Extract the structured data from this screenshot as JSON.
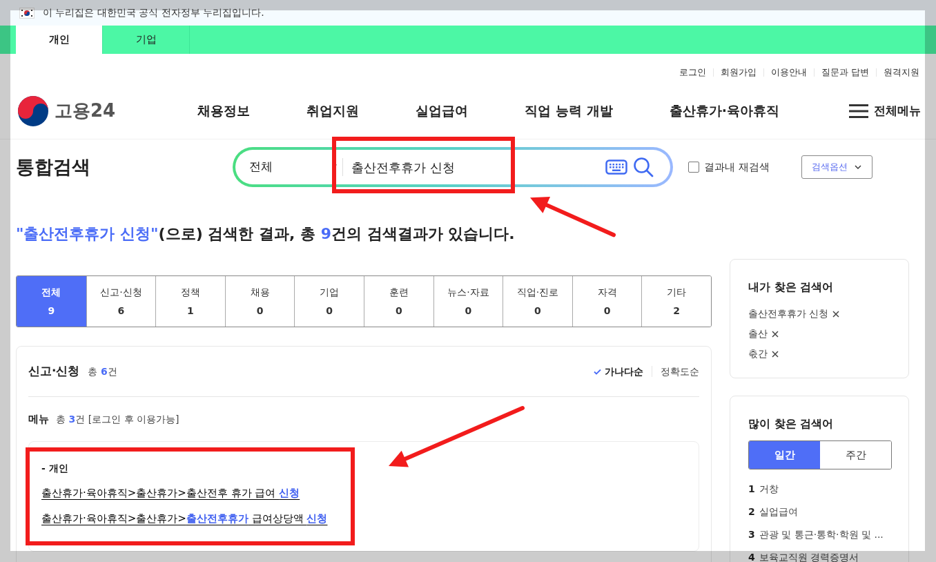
{
  "gov_banner": {
    "text": "이 누리집은 대한민국 공식 전자정부 누리집입니다."
  },
  "audience_tabs": [
    {
      "label": "개인",
      "selected": true
    },
    {
      "label": "기업",
      "selected": false
    }
  ],
  "util_links": [
    "로그인",
    "회원가입",
    "이용안내",
    "질문과 답변",
    "원격지원"
  ],
  "logo": {
    "text": "고용24"
  },
  "nav": [
    "채용정보",
    "취업지원",
    "실업급여",
    "직업 능력 개발",
    "출산휴가·육아휴직"
  ],
  "all_menu": "전체메뉴",
  "page_title": "통합검색",
  "search": {
    "scope": "전체",
    "value": "출산전후휴가 신청",
    "refine": {
      "label": "결과내 재검색",
      "checked": false
    },
    "options_button": "검색옵션"
  },
  "summary": {
    "query": "\"출산전후휴가 신청\"",
    "before_count": "(으로) 검색한 결과, 총 ",
    "count": "9",
    "after_count": "건의 검색결과가 있습니다."
  },
  "categories": [
    {
      "label": "전체",
      "count": "9",
      "selected": true
    },
    {
      "label": "신고·신청",
      "count": "6",
      "selected": false
    },
    {
      "label": "정책",
      "count": "1",
      "selected": false
    },
    {
      "label": "채용",
      "count": "0",
      "selected": false
    },
    {
      "label": "기업",
      "count": "0",
      "selected": false
    },
    {
      "label": "훈련",
      "count": "0",
      "selected": false
    },
    {
      "label": "뉴스·자료",
      "count": "0",
      "selected": false
    },
    {
      "label": "직업·진로",
      "count": "0",
      "selected": false
    },
    {
      "label": "자격",
      "count": "0",
      "selected": false
    },
    {
      "label": "기타",
      "count": "2",
      "selected": false
    }
  ],
  "section": {
    "title": "신고·신청",
    "total_prefix": "총 ",
    "total_count": "6",
    "total_suffix": "건",
    "sort": [
      {
        "label": "가나다순",
        "selected": true
      },
      {
        "label": "정확도순",
        "selected": false
      }
    ],
    "menu": {
      "title": "메뉴",
      "total_prefix": "총 ",
      "total_count": "3",
      "total_suffix": "건 [로그인 후 이용가능]",
      "group": "- 개인",
      "links": [
        {
          "parts": [
            {
              "text": "출산휴가·육아휴직>출산휴가>출산전후 휴가 급여 ",
              "highlight": false
            },
            {
              "text": "신청",
              "highlight": true
            }
          ]
        },
        {
          "parts": [
            {
              "text": "출산휴가·육아휴직>출산휴가>",
              "highlight": false
            },
            {
              "text": "출산전후휴가",
              "highlight": true
            },
            {
              "text": " 급여상당액 ",
              "highlight": false
            },
            {
              "text": "신청",
              "highlight": true
            }
          ]
        }
      ]
    }
  },
  "my_searches": {
    "title": "내가 찾은 검색어",
    "items": [
      "출산전후휴가 신청",
      "출산",
      "춗간"
    ]
  },
  "popular": {
    "title": "많이 찾은 검색어",
    "tabs": [
      {
        "label": "일간",
        "selected": true
      },
      {
        "label": "주간",
        "selected": false
      }
    ],
    "items": [
      {
        "rank": "1",
        "term": "거창"
      },
      {
        "rank": "2",
        "term": "실업급여"
      },
      {
        "rank": "3",
        "term": "관광 및 통근·통학·학원 및 ..."
      },
      {
        "rank": "4",
        "term": "보육교직원 경력증명서"
      }
    ]
  }
}
